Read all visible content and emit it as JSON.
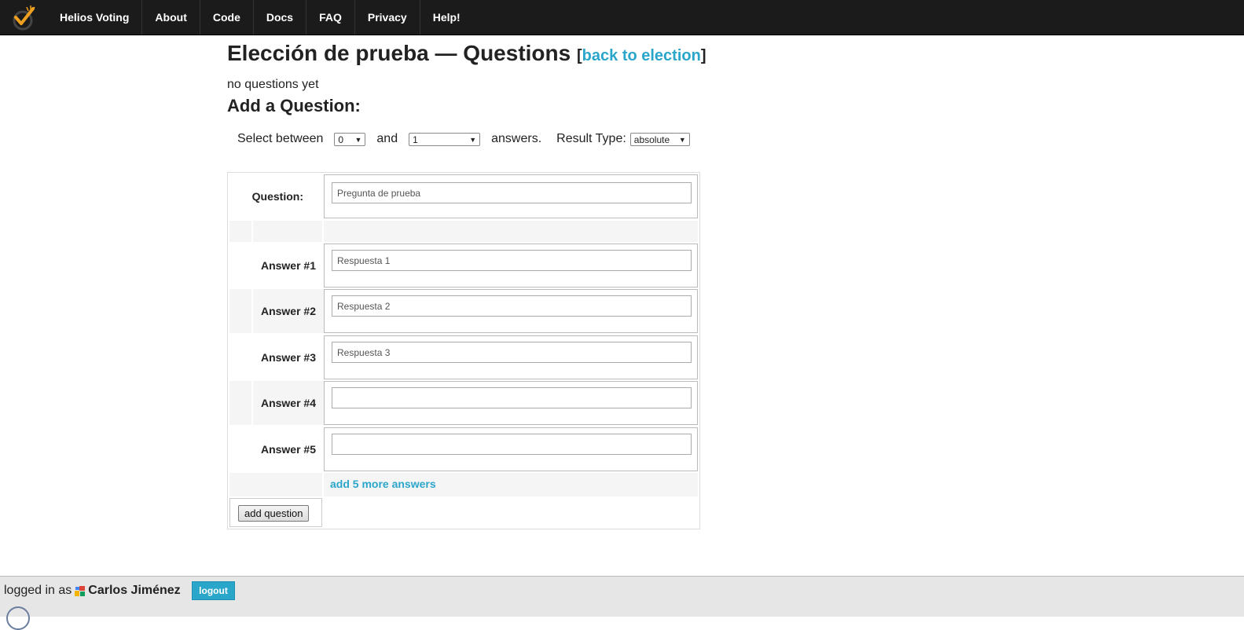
{
  "nav": {
    "brand": "Helios Voting",
    "items": [
      "About",
      "Code",
      "Docs",
      "FAQ",
      "Privacy",
      "Help!"
    ]
  },
  "page": {
    "title": "Elección de prueba — Questions",
    "back_link": "back to election",
    "no_questions": "no questions yet",
    "add_heading": "Add a Question:"
  },
  "selection": {
    "select_between": "Select between",
    "min_value": "0",
    "and": "and",
    "max_value": "1",
    "answers": "answers.",
    "result_type_label": "Result Type:",
    "result_type_value": "absolute"
  },
  "form": {
    "question_label": "Question:",
    "question_value": "Pregunta de prueba",
    "answers": [
      {
        "label": "Answer #1",
        "value": "Respuesta 1"
      },
      {
        "label": "Answer #2",
        "value": "Respuesta 2"
      },
      {
        "label": "Answer #3",
        "value": "Respuesta 3"
      },
      {
        "label": "Answer #4",
        "value": ""
      },
      {
        "label": "Answer #5",
        "value": ""
      }
    ],
    "add_more": "add 5 more answers",
    "submit": "add question"
  },
  "footer": {
    "logged_in_as": "logged in as",
    "user_name": "Carlos Jiménez",
    "logout": "logout"
  },
  "colors": {
    "accent": "#2ba6cb",
    "topbar": "#1b1b1b"
  }
}
